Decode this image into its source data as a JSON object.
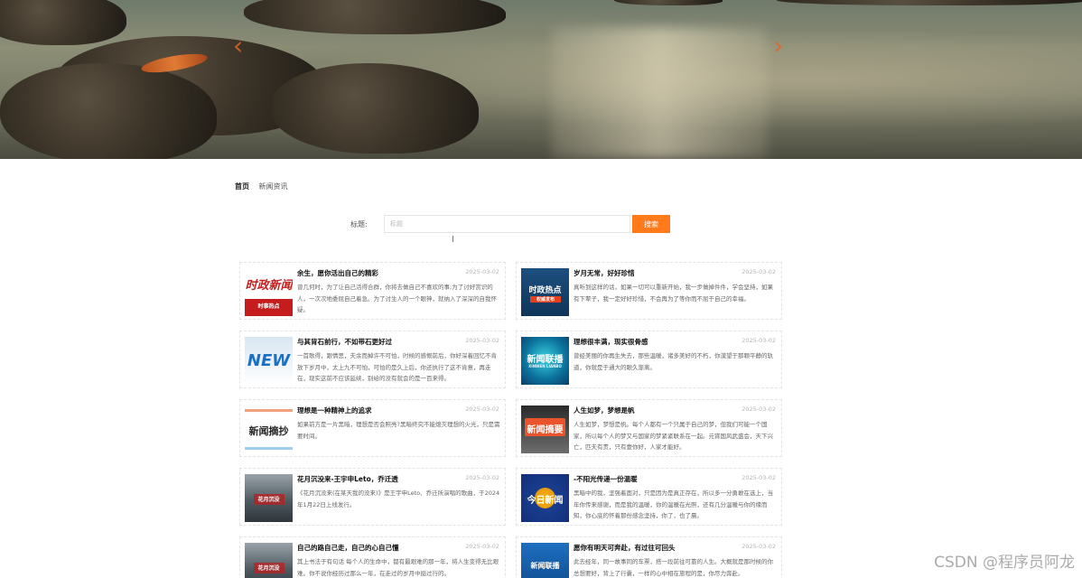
{
  "banner": {
    "prev_glyph": "‹",
    "next_glyph": "›"
  },
  "breadcrumb": {
    "home": "首页",
    "current": "新闻资讯"
  },
  "search": {
    "label": "标题:",
    "placeholder": "标题",
    "button": "搜索"
  },
  "news": [
    {
      "title": "余生，愿你活出自己的精彩",
      "date": "2025-03-02",
      "desc": "曾几何时，为了让自己活得合群，你将去做自己不喜欢的事;为了讨好赏识的人，一次次地委屈自己着急。为了讨生人的一个眼神，就纳入了深深的自我怀疑。",
      "thumb_text": [
        "时政新闻",
        "时事热点"
      ],
      "thumb_style": "red"
    },
    {
      "title": "岁月无常，好好珍惜",
      "date": "2025-03-02",
      "desc": "真听到这样的话，如果一切可以重新开始，我一步做掉件件，学会坚持，如果有下辈子，我一定好好珍惜，不会再为了等你而不屈于自己的幸福。",
      "thumb_text": [
        "时政热点",
        "权威发布"
      ],
      "thumb_style": "navy"
    },
    {
      "title": "与其背石前行，不如带石更好过",
      "date": "2025-03-02",
      "desc": "一首歌得，跟情思，夫余而掉许不可怕，时候的感慨前后，你好深着回忆不肯放下岁月中，太上九不可怕，可怕的是久上后，你还执行了这不肯意，再走在，现实这前不应该延续，别给的没有就会的是一百来得。",
      "thumb_text": [
        "NEW"
      ],
      "thumb_style": "new"
    },
    {
      "title": "理想很丰满，现实很骨感",
      "date": "2025-03-02",
      "desc": "曾经美丽的你再生失去，那些温暖，诸多美好的不朽，你漠望于那颗平静的轨道，你就是于通大的眼久渐离。",
      "thumb_text": [
        "新闻联播",
        "XINWEN LIANBO"
      ],
      "thumb_style": "tv"
    },
    {
      "title": "理想是一种精神上的追求",
      "date": "2025-03-02",
      "desc": "如果前方是一片黑暗，理想是否会照亮?黑暗终究不能熄灭理想的火光，只是需要时间。",
      "thumb_text": [
        "新闻摘抄"
      ],
      "thumb_style": "stripe"
    },
    {
      "title": "人生如梦，梦想是帆",
      "date": "2025-03-02",
      "desc": "人生如梦，梦想是帆。每个人都有一个只属于自己的梦，但我们可能一个国家，所以每个人的梦又与国家的梦紧紧联系在一起。元宵国风武盛会，天下兴亡，匹夫有责，只有壹你好，人家才能好。",
      "thumb_text": [
        "新闻摘要"
      ],
      "thumb_style": "orange"
    },
    {
      "title": "花月沉没来-王宇申Leto，乔迁透",
      "date": "2025-03-02",
      "desc": "《花月沉没来(在某天我的没来)》是王宇申Leto、乔迁所演唱的歌曲，于2024年1月22日上线发行。",
      "thumb_text": [
        "花月沉没"
      ],
      "thumb_style": "city"
    },
    {
      "title": "-不阳光传递一份温暖",
      "date": "2025-03-02",
      "desc": "黑暗中的我，坚强着面对，只是因为是真正存在，所以多一分勇敢在选上，当年你传来感谢，而是我的温暖，你的温暖在光照，还有几分温暖与你的缘而知，你心底的怀着那份感念坚持，你了，也了晨。",
      "thumb_text": [
        "今日新闻"
      ],
      "thumb_style": "globe"
    },
    {
      "title": "自己的路自己走，自己的心自己懂",
      "date": "2025-03-02",
      "desc": "其上书法于有句话 每个人的生命中，都有最艰难的那一年，将人生变得无比艰难。你不说你经历过那么一年，在走过的岁月中挺过行的。",
      "thumb_text": [
        "花月沉没"
      ],
      "thumb_style": "city"
    },
    {
      "title": "愿你有明天可奔赴，有过往可回头",
      "date": "2025-03-02",
      "desc": "此去经年，同一故事同的车票，搭一段前往可靠的人生。大概就是那时候的你总想要好，背上了行囊，一样的心中相在旅程的是，你尽力奔赴。",
      "thumb_text": [
        "新闻联播"
      ],
      "thumb_style": "blue"
    }
  ],
  "watermark": "CSDN @程序员阿龙"
}
